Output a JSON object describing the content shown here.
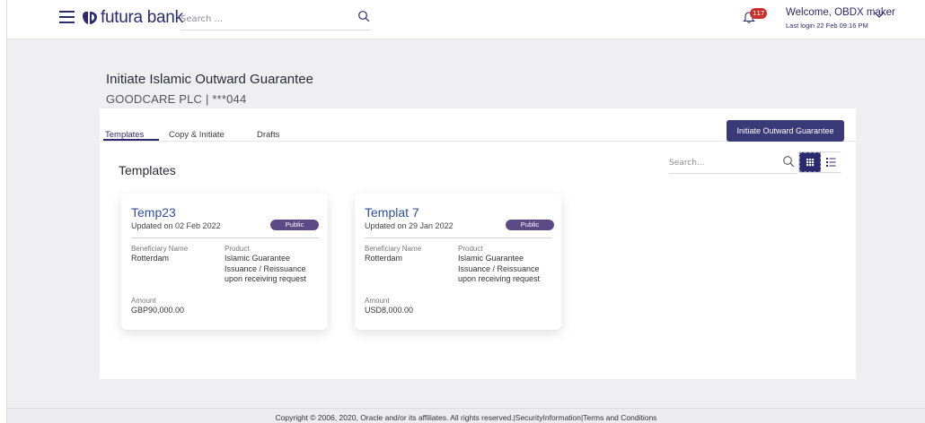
{
  "header": {
    "brand": "futura bank",
    "search_placeholder": "Search ...",
    "notification_count": "117",
    "welcome": "Welcome, OBDX maker",
    "last_login": "Last login 22 Feb 09:16 PM"
  },
  "page": {
    "title": "Initiate Islamic Outward Guarantee",
    "party": "GOODCARE PLC | ***044"
  },
  "tabs": [
    {
      "label": "Templates",
      "active": true
    },
    {
      "label": "Copy & Initiate",
      "active": false
    },
    {
      "label": "Drafts",
      "active": false
    }
  ],
  "actions": {
    "initiate_label": "Initiate Outward Guarantee"
  },
  "templates_section": {
    "title": "Templates",
    "search_placeholder": "Search...",
    "view_mode": "grid"
  },
  "cards": [
    {
      "name": "Temp23",
      "updated": "Updated on 02 Feb 2022",
      "visibility": "Public",
      "beneficiary_label": "Beneficiary Name",
      "beneficiary": "Rotterdam",
      "product_label": "Product",
      "product": "Islamic Guarantee Issuance / Reissuance upon receiving request",
      "amount_label": "Amount",
      "amount": "GBP90,000.00"
    },
    {
      "name": "Templat 7",
      "updated": "Updated on 29 Jan 2022",
      "visibility": "Public",
      "beneficiary_label": "Beneficiary Name",
      "beneficiary": "Rotterdam",
      "product_label": "Product",
      "product": "Islamic Guarantee Issuance / Reissuance upon receiving request",
      "amount_label": "Amount",
      "amount": "USD8,000.00"
    }
  ],
  "footer": {
    "text": "Copyright © 2006, 2020, Oracle and/or its affiliates. All rights reserved.|SecurityInformation|Terms and Conditions"
  },
  "colors": {
    "brand": "#2c2a6f",
    "button": "#3b3a78",
    "badge": "#5a4a86",
    "link": "#2f4f9e"
  }
}
